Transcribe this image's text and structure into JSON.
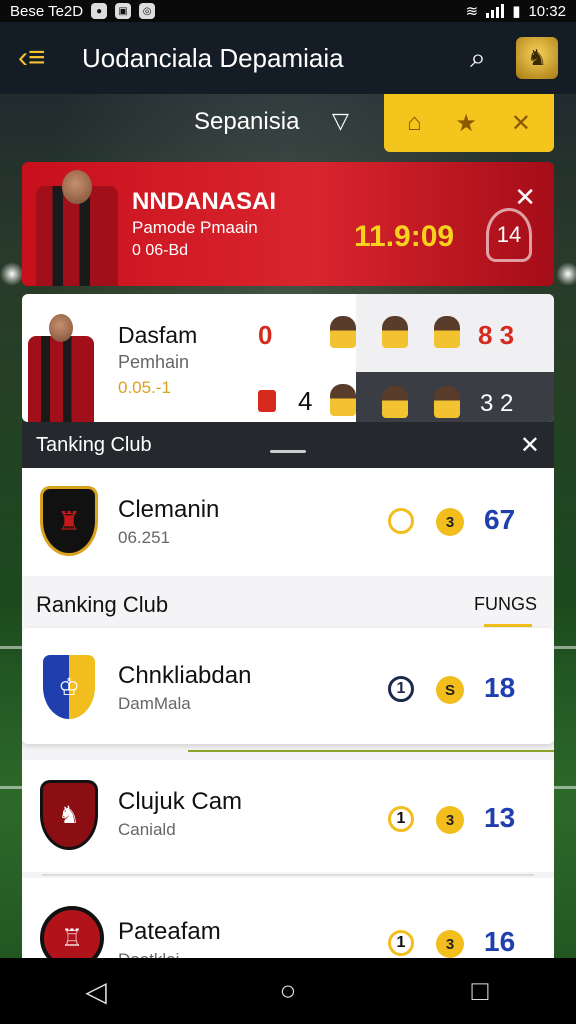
{
  "status_bar": {
    "left_text": "Bese Te2D",
    "time": "10:32"
  },
  "app_bar": {
    "title": "Uodanciala Depamiaia",
    "menu_icon": "back-menu-icon",
    "search_icon": "search-icon"
  },
  "filter": {
    "season_label": "Sepanisia",
    "tools": [
      "bookmark-icon",
      "star-icon",
      "close-icon"
    ]
  },
  "featured": {
    "name": "NNDANASAI",
    "subtitle": "Pamode Pmaain",
    "detail": "0 06-Bd",
    "time": "11.9:09",
    "badge": "14"
  },
  "match": {
    "name": "Dasfam",
    "subtitle": "Pemhain",
    "detail": "0.05.-1",
    "home_score_top": "0",
    "home_score_bottom": "4",
    "right_top": "8 3",
    "right_bottom": "3 2"
  },
  "sheet": {
    "header_title": "Tanking Club",
    "rank_title": "Ranking Club",
    "tab_label": "FUNGS",
    "clubs": [
      {
        "name": "Clemanin",
        "subtitle": "06.251",
        "circle1": "",
        "circle2": "3",
        "points": "67"
      },
      {
        "name": "Chnkliabdan",
        "subtitle": "DamMala",
        "circle1": "1",
        "circle2": "S",
        "points": "18"
      },
      {
        "name": "Clujuk Cam",
        "subtitle": "Caniald",
        "circle1": "1",
        "circle2": "3",
        "points": "13"
      },
      {
        "name": "Pateafam",
        "subtitle": "Dootkloi",
        "circle1": "1",
        "circle2": "3",
        "points": "16"
      }
    ]
  },
  "colors": {
    "accent_yellow": "#f4c51d",
    "featured_red": "#d9252e",
    "points_blue": "#1f3fae"
  }
}
